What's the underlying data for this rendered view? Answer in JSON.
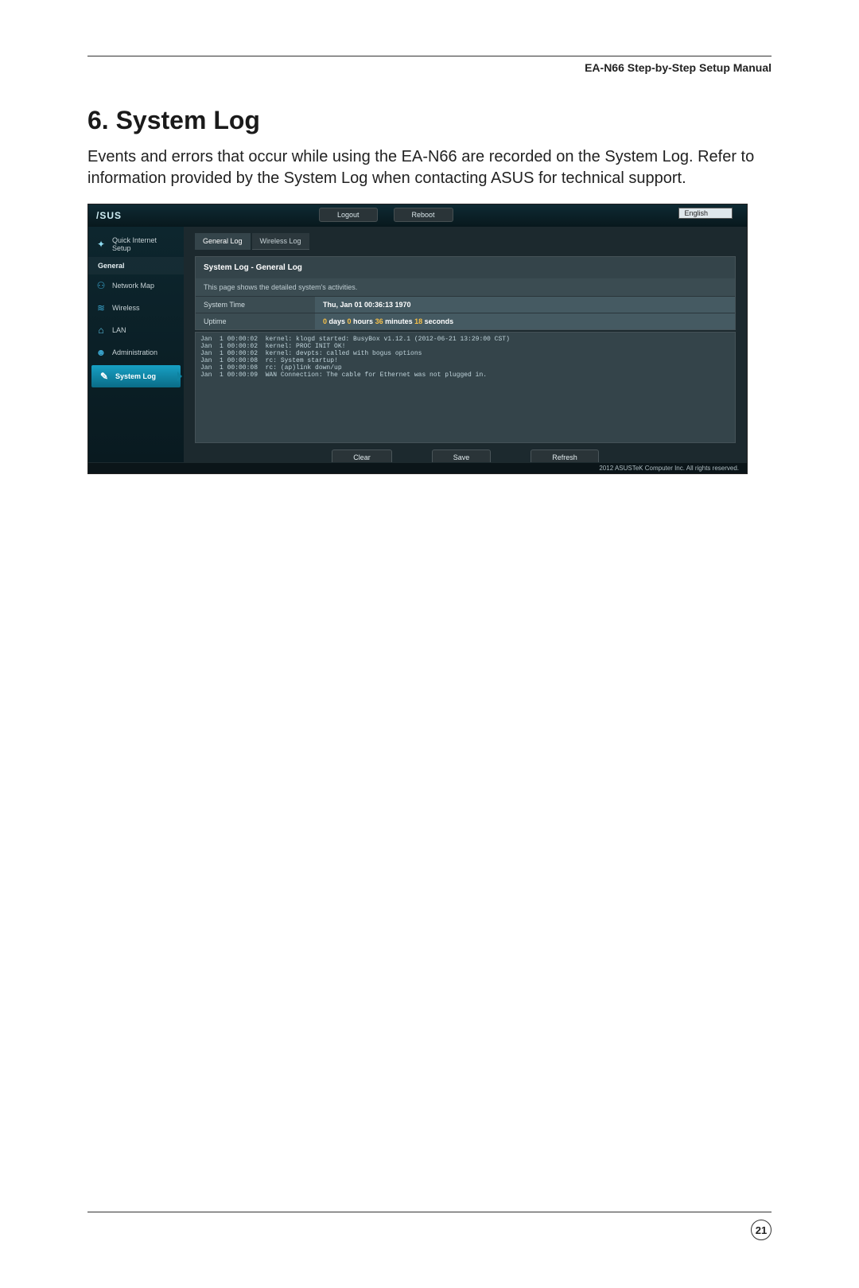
{
  "doc": {
    "header": "EA-N66 Step-by-Step Setup Manual",
    "section_title": "6. System Log",
    "section_body": "Events and errors that occur while using the EA-N66 are recorded on the System Log. Refer to information provided by the System Log when contacting ASUS for technical support.",
    "page_number": "21"
  },
  "ui": {
    "logo": "/SUS",
    "top_buttons": {
      "logout": "Logout",
      "reboot": "Reboot"
    },
    "language": "English",
    "sidebar": {
      "quick_setup": "Quick Internet Setup",
      "general_header": "General",
      "items": [
        {
          "label": "Network Map"
        },
        {
          "label": "Wireless"
        },
        {
          "label": "LAN"
        },
        {
          "label": "Administration"
        },
        {
          "label": "System Log"
        }
      ]
    },
    "tabs": {
      "general": "General Log",
      "wireless": "Wireless Log"
    },
    "panel": {
      "title": "System Log - General Log",
      "desc": "This page shows the detailed system's activities.",
      "system_time_label": "System Time",
      "system_time_value": "Thu, Jan 01  00:36:13  1970",
      "uptime_label": "Uptime",
      "uptime_value_prefix1": "0",
      "uptime_value_text1": " days ",
      "uptime_value_prefix2": "0",
      "uptime_value_text2": " hours ",
      "uptime_value_prefix3": "36",
      "uptime_value_text3": " minutes ",
      "uptime_value_prefix4": "18",
      "uptime_value_text4": " seconds"
    },
    "log_lines": "Jan  1 00:00:02  kernel: klogd started: BusyBox v1.12.1 (2012-06-21 13:29:00 CST)\nJan  1 00:00:02  kernel: PROC INIT OK!\nJan  1 00:00:02  kernel: devpts: called with bogus options\nJan  1 00:00:08  rc: System startup!\nJan  1 00:00:08  rc: (ap)link down/up\nJan  1 00:00:09  WAN Connection: The cable for Ethernet was not plugged in.",
    "actions": {
      "clear": "Clear",
      "save": "Save",
      "refresh": "Refresh"
    },
    "footer": "2012 ASUSTeK Computer Inc. All rights reserved."
  }
}
